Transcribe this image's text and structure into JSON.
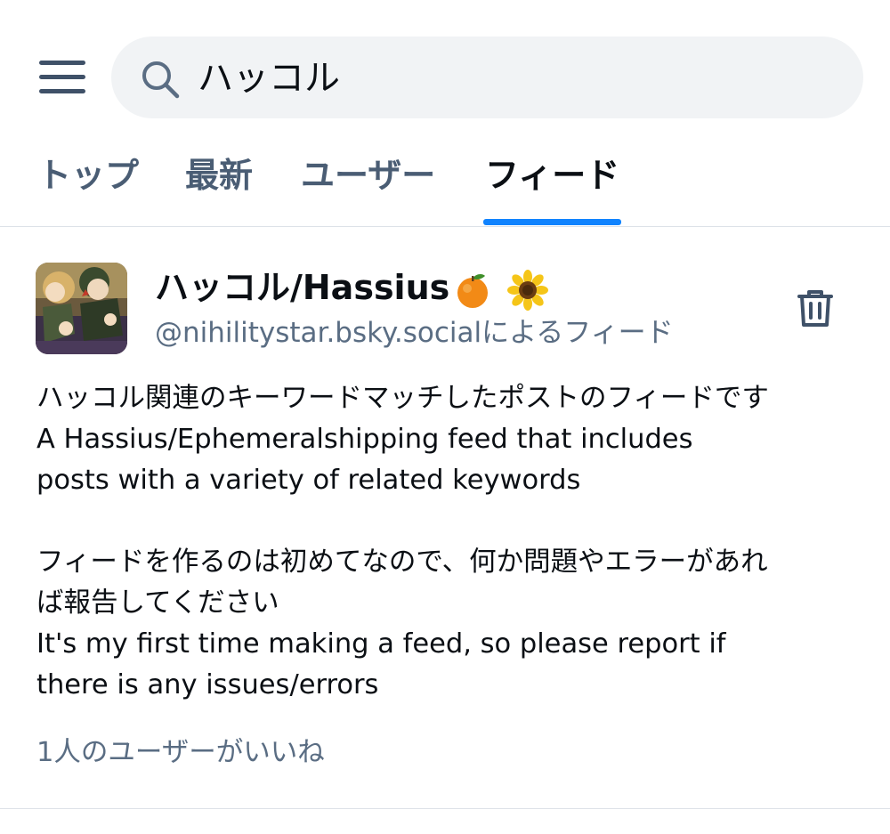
{
  "search": {
    "query": "ハッコル"
  },
  "tabs": [
    {
      "label": "トップ",
      "active": false
    },
    {
      "label": "最新",
      "active": false
    },
    {
      "label": "ユーザー",
      "active": false
    },
    {
      "label": "フィード",
      "active": true
    }
  ],
  "feed": {
    "name": "ハッコル/Hassius",
    "name_emojis": [
      "🍊",
      "🌻"
    ],
    "creator": "@nihilitystar.bsky.socialによるフィード",
    "description": "ハッコル関連のキーワードマッチしたポストのフィードです\nA Hassius/Ephemeralshipping feed that includes\nposts with a variety of related keywords\n\nフィードを作るのは初めてなので、何か問題やエラーがあれ\nば報告してください\nIt's my first time making a feed, so please report if\nthere is any issues/errors",
    "likes": "1人のユーザーがいいね"
  },
  "icons": {
    "menu": "hamburger-menu-icon",
    "search": "search-icon",
    "delete": "trash-icon"
  },
  "colors": {
    "accent": "#1083fe",
    "icon_gray": "#3f5168",
    "secondary_text": "#5a6d83",
    "search_bg": "#f1f3f5"
  }
}
